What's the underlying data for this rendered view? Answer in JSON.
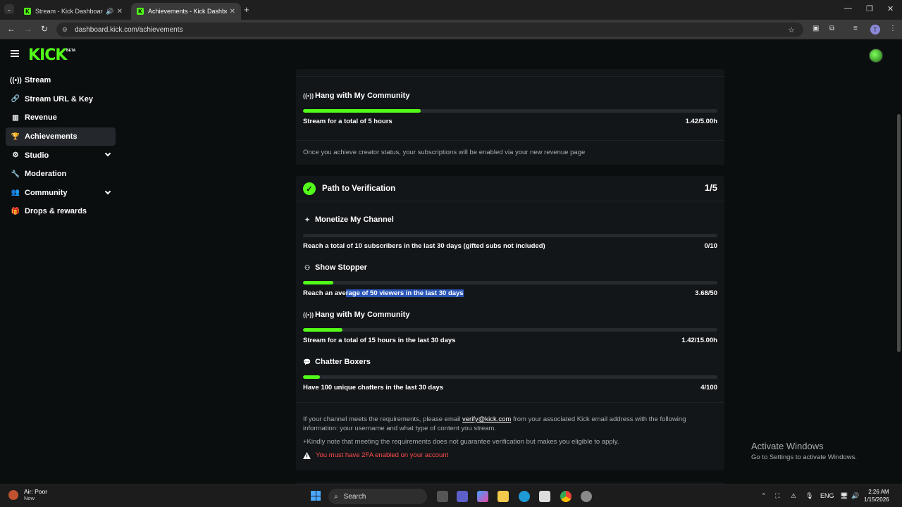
{
  "browser": {
    "tabs": [
      {
        "title": "Stream - Kick Dashboard",
        "active": false
      },
      {
        "title": "Achievements - Kick Dashboard",
        "active": true
      }
    ],
    "url": "dashboard.kick.com/achievements",
    "profile_initial": "T"
  },
  "header": {
    "logo": "KICK",
    "beta": "BETA"
  },
  "sidebar": {
    "items": [
      {
        "label": "Stream",
        "icon": "broadcast-icon",
        "active": false
      },
      {
        "label": "Stream URL & Key",
        "icon": "link-icon",
        "active": false
      },
      {
        "label": "Revenue",
        "icon": "chart-icon",
        "active": false
      },
      {
        "label": "Achievements",
        "icon": "trophy-icon",
        "active": true
      },
      {
        "label": "Studio",
        "icon": "gear-icon",
        "active": false,
        "expandable": true
      },
      {
        "label": "Moderation",
        "icon": "wrench-icon",
        "active": false
      },
      {
        "label": "Community",
        "icon": "people-icon",
        "active": false,
        "expandable": true
      },
      {
        "label": "Drops & rewards",
        "icon": "gift-icon",
        "active": false
      }
    ]
  },
  "creator_card": {
    "achievement": {
      "title": "Hang with My Community",
      "requirement": "Stream for a total of 5 hours",
      "progress_text": "1.42/5.00h",
      "progress": 0.284
    },
    "note": "Once you achieve creator status, your subscriptions will be enabled via your new revenue page"
  },
  "verification": {
    "title": "Path to Verification",
    "count": "1/5",
    "achievements": [
      {
        "title": "Monetize My Channel",
        "icon": "sparkle-icon",
        "requirement": "Reach a total of 10 subscribers in the last 30 days (gifted subs not included)",
        "progress_text": "0/10",
        "progress": 0.0
      },
      {
        "title": "Show Stopper",
        "icon": "people-icon",
        "requirement_pre": "Reach an ave",
        "requirement_selected": "rage of 50 viewers in the last 30 days",
        "progress_text": "3.68/50",
        "progress": 0.0736
      },
      {
        "title": "Hang with My Community",
        "icon": "broadcast-icon",
        "requirement": "Stream for a total of 15 hours in the last 30 days",
        "progress_text": "1.42/15.00h",
        "progress": 0.0947
      },
      {
        "title": "Chatter Boxers",
        "icon": "chat-icon",
        "requirement": "Have 100 unique chatters in the last 30 days",
        "progress_text": "4/100",
        "progress": 0.04
      }
    ],
    "info_pre": "If your channel meets the requirements, please email ",
    "info_email": "verify@kick.com",
    "info_post": " from your associated Kick email address with the following information: your username and what type of content you stream.",
    "kindly_note": "+Kindly note that meeting the requirements does not guarantee verification but makes you eligible to apply.",
    "warning": "You must have 2FA enabled on your account"
  },
  "watermark": {
    "line1": "Activate Windows",
    "line2": "Go to Settings to activate Windows."
  },
  "taskbar": {
    "weather_title": "Air: Poor",
    "weather_sub": "Now",
    "search": "Search",
    "lang": "ENG",
    "time": "2:26 AM",
    "date": "1/15/2026"
  },
  "colors": {
    "accent": "#53fc18",
    "card": "#131619",
    "bg": "#0b0e0f",
    "warning": "#ff4c4c"
  }
}
